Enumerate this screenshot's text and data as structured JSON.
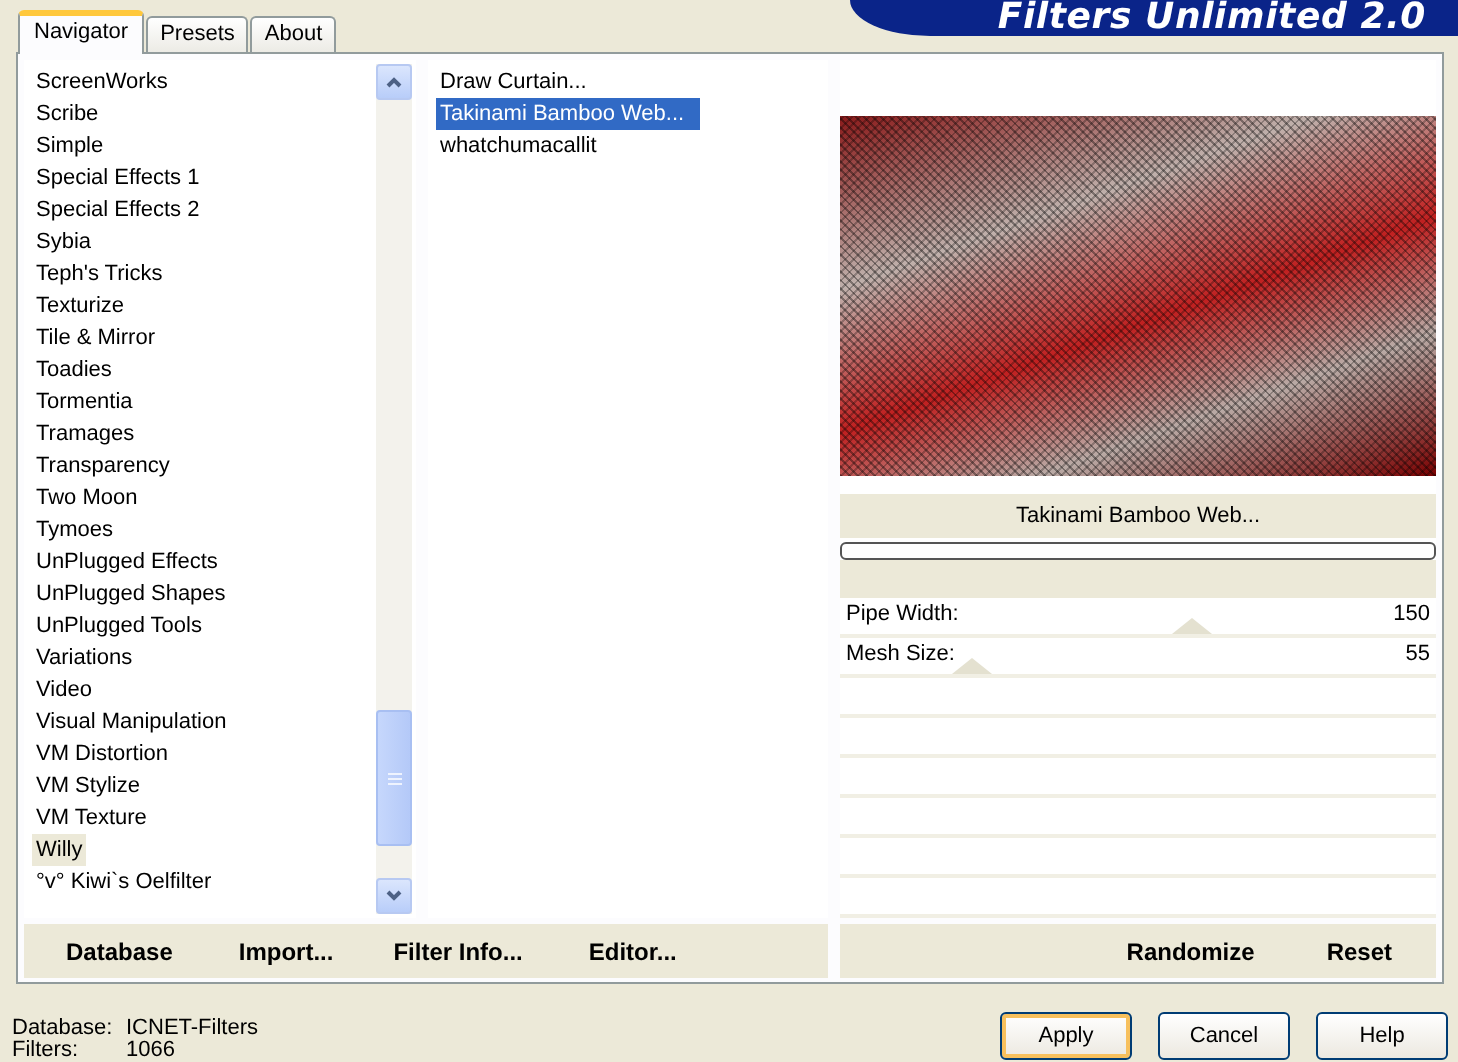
{
  "banner": {
    "title": "Filters Unlimited 2.0"
  },
  "tabs": [
    {
      "label": "Navigator",
      "selected": true
    },
    {
      "label": "Presets",
      "selected": false
    },
    {
      "label": "About",
      "selected": false
    }
  ],
  "categories": [
    {
      "label": "ScreenWorks",
      "selected": false
    },
    {
      "label": "Scribe",
      "selected": false
    },
    {
      "label": "Simple",
      "selected": false
    },
    {
      "label": "Special Effects 1",
      "selected": false
    },
    {
      "label": "Special Effects 2",
      "selected": false
    },
    {
      "label": "Sybia",
      "selected": false
    },
    {
      "label": "Teph's Tricks",
      "selected": false
    },
    {
      "label": "Texturize",
      "selected": false
    },
    {
      "label": "Tile & Mirror",
      "selected": false
    },
    {
      "label": "Toadies",
      "selected": false
    },
    {
      "label": "Tormentia",
      "selected": false
    },
    {
      "label": "Tramages",
      "selected": false
    },
    {
      "label": "Transparency",
      "selected": false
    },
    {
      "label": "Two Moon",
      "selected": false
    },
    {
      "label": "Tymoes",
      "selected": false
    },
    {
      "label": "UnPlugged Effects",
      "selected": false
    },
    {
      "label": "UnPlugged Shapes",
      "selected": false
    },
    {
      "label": "UnPlugged Tools",
      "selected": false
    },
    {
      "label": "Variations",
      "selected": false
    },
    {
      "label": "Video",
      "selected": false
    },
    {
      "label": "Visual Manipulation",
      "selected": false
    },
    {
      "label": "VM Distortion",
      "selected": false
    },
    {
      "label": "VM Stylize",
      "selected": false
    },
    {
      "label": "VM Texture",
      "selected": false
    },
    {
      "label": "Willy",
      "selected": true
    },
    {
      "label": "°v° Kiwi`s Oelfilter",
      "selected": false
    }
  ],
  "filters": [
    {
      "label": "Draw Curtain...",
      "selected": false
    },
    {
      "label": "Takinami Bamboo Web...",
      "selected": true
    },
    {
      "label": "whatchumacallit",
      "selected": false
    }
  ],
  "preview": {
    "filter_name": "Takinami Bamboo Web...",
    "progress": {
      "level": 0
    }
  },
  "parameters": [
    {
      "label": "Pipe Width:",
      "value": "150",
      "level": 0.59
    },
    {
      "label": "Mesh Size:",
      "value": "55",
      "level": 0.22
    }
  ],
  "panel_buttons": [
    "Database",
    "Import...",
    "Filter Info...",
    "Editor..."
  ],
  "preview_buttons": [
    "Randomize",
    "Reset"
  ],
  "status": [
    {
      "label": "Database:",
      "value": "ICNET-Filters"
    },
    {
      "label": "Filters:",
      "value": "1066"
    }
  ],
  "dialog_buttons": [
    {
      "label": "Apply",
      "default": true
    },
    {
      "label": "Cancel",
      "default": false
    },
    {
      "label": "Help",
      "default": false
    }
  ]
}
